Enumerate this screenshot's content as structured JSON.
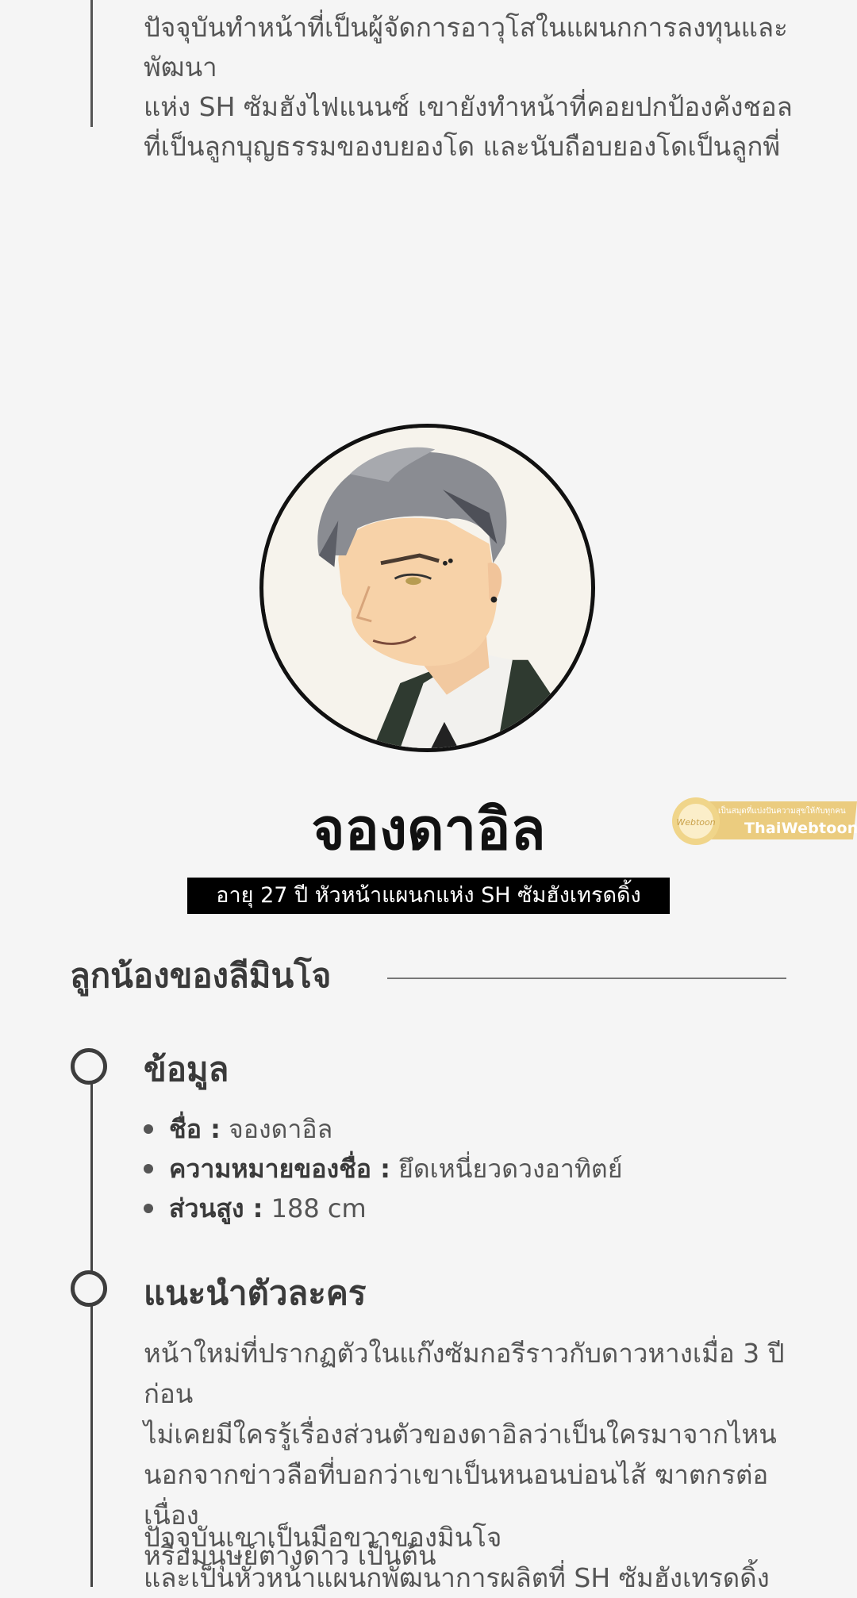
{
  "intro_continued": {
    "lines": [
      "ปัจจุบันทำหน้าที่เป็นผู้จัดการอาวุโสในแผนกการลงทุนและพัฒนา",
      "แห่ง SH ซัมฮังไฟแนนซ์ เขายังทำหน้าที่คอยปกป้องคังชอล",
      "ที่เป็นลูกบุญธรรมของบยองโด และนับถือบยองโดเป็นลูกพี่"
    ]
  },
  "character": {
    "name": "จองดาอิล",
    "subtitle": "อายุ 27 ปี หัวหน้าแผนกแห่ง SH ซัมฮังเทรดดิ้ง"
  },
  "group": {
    "title": "ลูกน้องของลีมินโจ"
  },
  "info": {
    "title": "ข้อมูล",
    "items": [
      {
        "label": "ชื่อ :",
        "value": " จองดาอิล"
      },
      {
        "label": "ความหมายของชื่อ :",
        "value": " ยึดเหนี่ยวดวงอาทิตย์"
      },
      {
        "label": "ส่วนสูง :",
        "value": " 188 cm"
      }
    ]
  },
  "intro": {
    "title": "แนะนำตัวละคร",
    "paragraph1": [
      "หน้าใหม่ที่ปรากฏตัวในแก๊งซัมกอรีราวกับดาวหางเมื่อ 3 ปีก่อน",
      "ไม่เคยมีใครรู้เรื่องส่วนตัวของดาอิลว่าเป็นใครมาจากไหน",
      "นอกจากข่าวลือที่บอกว่าเขาเป็นหนอนบ่อนไส้ ฆาตกรต่อเนื่อง",
      "หรือมนุษย์ต่างดาว เป็นต้น"
    ],
    "paragraph2": [
      "ปัจจุบันเขาเป็นมือขวาของมินโจ",
      "และเป็นหัวหน้าแผนกพัฒนาการผลิตที่ SH ซัมฮังเทรดดิ้ง"
    ]
  },
  "watermark": {
    "tagline": "เป็นสมุดที่แบ่งปันความสุขให้กับทุกคน",
    "brand": "ThaiWebtoon"
  },
  "colors": {
    "background": "#f5f5f5",
    "banner": "#000000",
    "text": "#555555",
    "watermark_gold": "#e9c46a"
  }
}
